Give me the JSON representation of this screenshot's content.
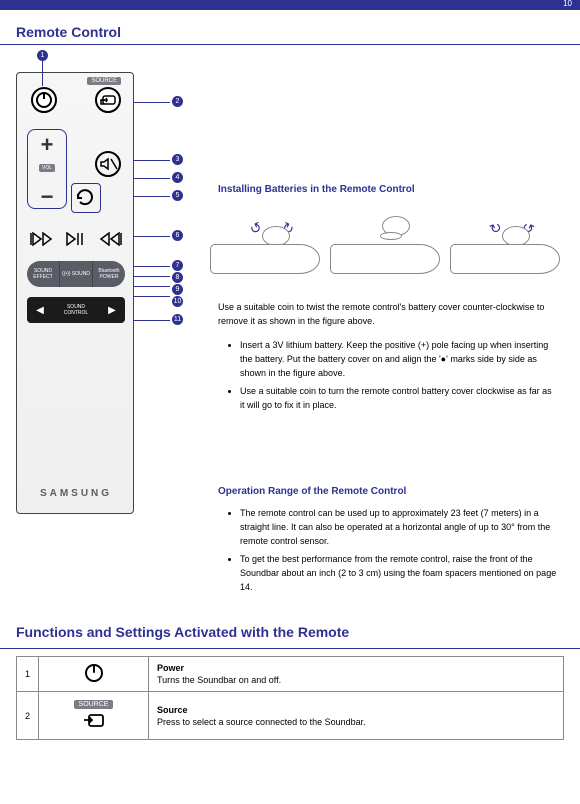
{
  "page": {
    "number": "10",
    "section_title": "Remote Control"
  },
  "remote": {
    "brand": "SAMSUNG",
    "source_btn_label": "SOURCE",
    "vol_label": "VOL",
    "sound_effect": "SOUND\nEFFECT",
    "surround": "((•))\nSOUND",
    "bt_power": "Bluetooth\nPOWER",
    "sound_control": "SOUND\nCONTROL"
  },
  "callouts": [
    "1",
    "2",
    "3",
    "4",
    "5",
    "6",
    "7",
    "8",
    "9",
    "10",
    "11"
  ],
  "battery": {
    "title": "Installing Batteries in the Remote Control",
    "coin_text": "Use a suitable coin to twist the remote control's battery cover counter-clockwise to remove it as shown in the figure above.",
    "bullets": [
      "Insert a 3V lithium battery. Keep the positive (+) pole facing up when inserting the battery. Put the battery cover on and align the '●' marks side by side as shown in the figure above.",
      "Use a suitable coin to turn the remote control battery cover clockwise as far as it will go to fix it in place."
    ],
    "range_title": "Operation Range of the Remote Control",
    "range_bullets": [
      "The remote control can be used up to approximately 23 feet (7 meters) in a straight line. It can also be operated at a horizontal angle of up to 30° from the remote control sensor.",
      "To get the best performance from the remote control, raise the front of the Soundbar about an inch (2 to 3 cm) using the foam spacers mentioned on page 14."
    ]
  },
  "summary": {
    "title": "Functions and Settings Activated with the Remote",
    "rows": [
      {
        "num": "1",
        "icon": "power",
        "icon_label": "",
        "name": "Power",
        "desc": "Turns the Soundbar on and off."
      },
      {
        "num": "2",
        "icon": "source",
        "icon_label": "SOURCE",
        "name": "Source",
        "desc": "Press to select a source connected to the Soundbar."
      }
    ]
  }
}
